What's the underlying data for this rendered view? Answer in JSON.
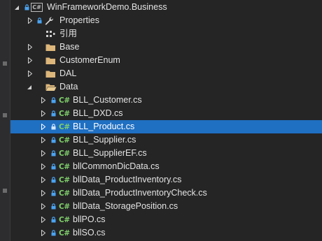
{
  "project": {
    "name": "WinFrameworkDemo.Business",
    "badge": "C#"
  },
  "items": [
    {
      "label": "Properties",
      "type": "properties"
    },
    {
      "label": "引用",
      "type": "references"
    },
    {
      "label": "Base",
      "type": "folder"
    },
    {
      "label": "CustomerEnum",
      "type": "folder"
    },
    {
      "label": "DAL",
      "type": "folder"
    },
    {
      "label": "Data",
      "type": "folder-open"
    }
  ],
  "files": [
    {
      "label": "BLL_Customer.cs"
    },
    {
      "label": "BLL_DXD.cs"
    },
    {
      "label": "BLL_Product.cs",
      "selected": true
    },
    {
      "label": "BLL_Supplier.cs"
    },
    {
      "label": "BLL_SupplierEF.cs"
    },
    {
      "label": "bllCommonDicData.cs"
    },
    {
      "label": "bllData_ProductInventory.cs"
    },
    {
      "label": "bllData_ProductInventoryCheck.cs"
    },
    {
      "label": "bllData_StoragePosition.cs"
    },
    {
      "label": "bllPO.cs"
    },
    {
      "label": "bllSO.cs"
    }
  ],
  "cs_icon_text": "C#",
  "colors": {
    "background": "#252526",
    "selection": "#1f6fc2",
    "folder": "#dcb67a",
    "csharp": "#7fd06a",
    "lock": "#4aa3f0"
  }
}
